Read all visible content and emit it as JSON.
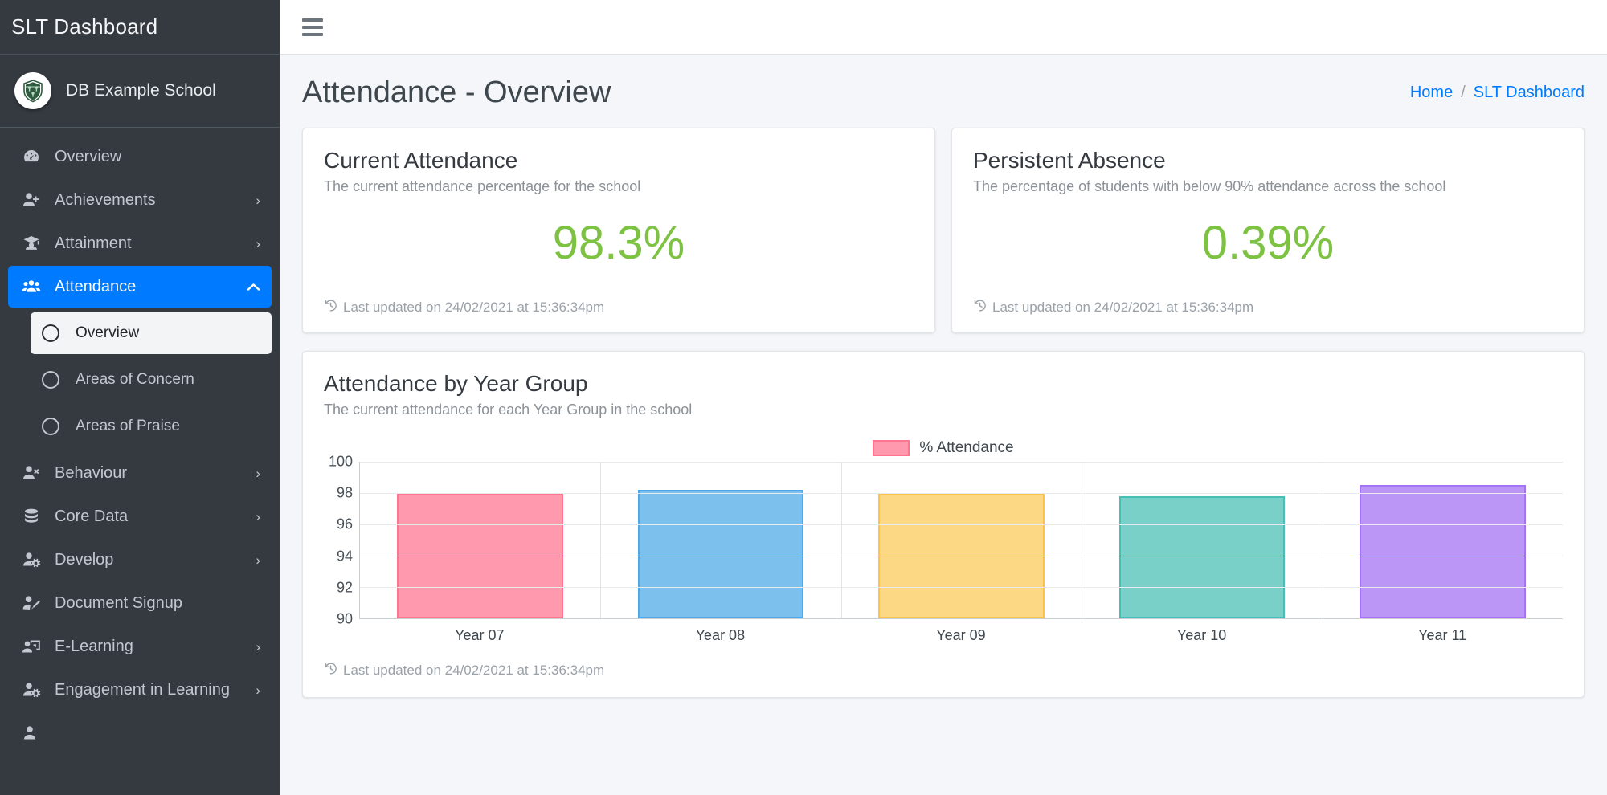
{
  "sidebar": {
    "brand_title": "SLT Dashboard",
    "school_name": "DB Example School",
    "school_logo_icon": "school-shield-icon",
    "items": [
      {
        "label": "Overview",
        "icon": "speedometer-icon",
        "arrow": "",
        "active": false
      },
      {
        "label": "Achievements",
        "icon": "user-plus-icon",
        "arrow": "›",
        "active": false
      },
      {
        "label": "Attainment",
        "icon": "graduation-cap-icon",
        "arrow": "›",
        "active": false
      },
      {
        "label": "Attendance",
        "icon": "users-group-icon",
        "arrow": "⌃",
        "active": true
      },
      {
        "label": "Behaviour",
        "icon": "user-times-icon",
        "arrow": "›",
        "active": false
      },
      {
        "label": "Core Data",
        "icon": "database-icon",
        "arrow": "›",
        "active": false
      },
      {
        "label": "Develop",
        "icon": "user-cog-icon",
        "arrow": "›",
        "active": false
      },
      {
        "label": "Document Signup",
        "icon": "user-edit-icon",
        "arrow": "",
        "active": false
      },
      {
        "label": "E-Learning",
        "icon": "user-screen-icon",
        "arrow": "›",
        "active": false
      },
      {
        "label": "Engagement in Learning",
        "icon": "user-cog-icon",
        "arrow": "›",
        "active": false
      }
    ],
    "sub_items": [
      {
        "label": "Overview",
        "icon": "circle-icon",
        "active": true
      },
      {
        "label": "Areas of Concern",
        "icon": "circle-icon",
        "active": false
      },
      {
        "label": "Areas of Praise",
        "icon": "circle-icon",
        "active": false
      }
    ]
  },
  "topbar": {
    "menu_toggle_icon": "hamburger-icon"
  },
  "page": {
    "title": "Attendance - Overview",
    "breadcrumb": {
      "home": "Home",
      "separator": "/",
      "current": "SLT Dashboard"
    }
  },
  "cards": [
    {
      "title": "Current Attendance",
      "subtitle": "The current attendance percentage for the school",
      "value": "98.3%",
      "value_color": "#7dc242",
      "footer": "Last updated on 24/02/2021 at 15:36:34pm",
      "footer_icon": "history-clock-icon"
    },
    {
      "title": "Persistent Absence",
      "subtitle": "The percentage of students with below 90% attendance across the school",
      "value": "0.39%",
      "value_color": "#7dc242",
      "footer": "Last updated on 24/02/2021 at 15:36:34pm",
      "footer_icon": "history-clock-icon"
    }
  ],
  "chart_card": {
    "title": "Attendance by Year Group",
    "subtitle": "The current attendance for each Year Group in the school",
    "footer": "Last updated on 24/02/2021 at 15:36:34pm",
    "footer_icon": "history-clock-icon"
  },
  "chart_data": {
    "type": "bar",
    "title": "Attendance by Year Group",
    "xlabel": "",
    "ylabel": "",
    "categories": [
      "Year 07",
      "Year 08",
      "Year 09",
      "Year 10",
      "Year 11"
    ],
    "values": [
      98.0,
      98.2,
      98.0,
      97.8,
      98.5
    ],
    "series": [
      {
        "name": "% Attendance",
        "values": [
          98.0,
          98.2,
          98.0,
          97.8,
          98.5
        ]
      }
    ],
    "bar_colors": [
      "#ff9aae",
      "#7cc0ee",
      "#fcd884",
      "#78d0c8",
      "#bb96f7"
    ],
    "bar_border_colors": [
      "#fd7591",
      "#4da7e8",
      "#f9c44d",
      "#46c0b5",
      "#a473f5"
    ],
    "ylim": [
      90,
      100
    ],
    "yticks": [
      90,
      92,
      94,
      96,
      98,
      100
    ],
    "ytick_labels": [
      "90",
      "92",
      "94",
      "96",
      "98",
      "100"
    ],
    "grid": true,
    "legend": {
      "position": "top-center",
      "entries": [
        "% Attendance"
      ],
      "swatch_color": "#ff9aae"
    }
  }
}
